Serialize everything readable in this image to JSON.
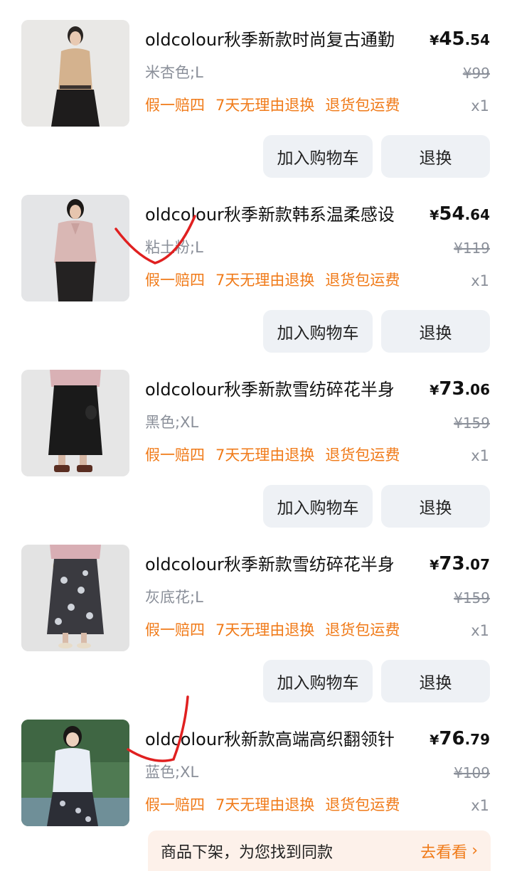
{
  "items": [
    {
      "title": "oldcolour秋季新款时尚复古通勤",
      "price_currency": "¥",
      "price_int": "45",
      "price_dec": ".54",
      "spec": "米杏色;L",
      "original_price": "¥99",
      "tags": [
        "假一赔四",
        "7天无理由退换",
        "退货包运费"
      ],
      "qty": "x1",
      "cart_label": "加入购物车",
      "return_label": "退换"
    },
    {
      "title": "oldcolour秋季新款韩系温柔感设",
      "price_currency": "¥",
      "price_int": "54",
      "price_dec": ".64",
      "spec": "粘土粉;L",
      "original_price": "¥119",
      "tags": [
        "假一赔四",
        "7天无理由退换",
        "退货包运费"
      ],
      "qty": "x1",
      "cart_label": "加入购物车",
      "return_label": "退换"
    },
    {
      "title": "oldcolour秋季新款雪纺碎花半身",
      "price_currency": "¥",
      "price_int": "73",
      "price_dec": ".06",
      "spec": "黑色;XL",
      "original_price": "¥159",
      "tags": [
        "假一赔四",
        "7天无理由退换",
        "退货包运费"
      ],
      "qty": "x1",
      "cart_label": "加入购物车",
      "return_label": "退换"
    },
    {
      "title": "oldcolour秋季新款雪纺碎花半身",
      "price_currency": "¥",
      "price_int": "73",
      "price_dec": ".07",
      "spec": "灰底花;L",
      "original_price": "¥159",
      "tags": [
        "假一赔四",
        "7天无理由退换",
        "退货包运费"
      ],
      "qty": "x1",
      "cart_label": "加入购物车",
      "return_label": "退换"
    },
    {
      "title": "oldcolour秋新款高端高织翻领针",
      "price_currency": "¥",
      "price_int": "76",
      "price_dec": ".79",
      "spec": "蓝色;XL",
      "original_price": "¥109",
      "tags": [
        "假一赔四",
        "7天无理由退换",
        "退货包运费"
      ],
      "qty": "x1"
    }
  ],
  "banner": {
    "text": "商品下架，为您找到同款",
    "link": "去看看",
    "link_icon": "chevron-right-icon"
  },
  "colors": {
    "accent_orange": "#f07a18",
    "muted_gray": "#8a8f99",
    "button_bg": "#eef1f5",
    "annotation_red": "#e02020"
  }
}
